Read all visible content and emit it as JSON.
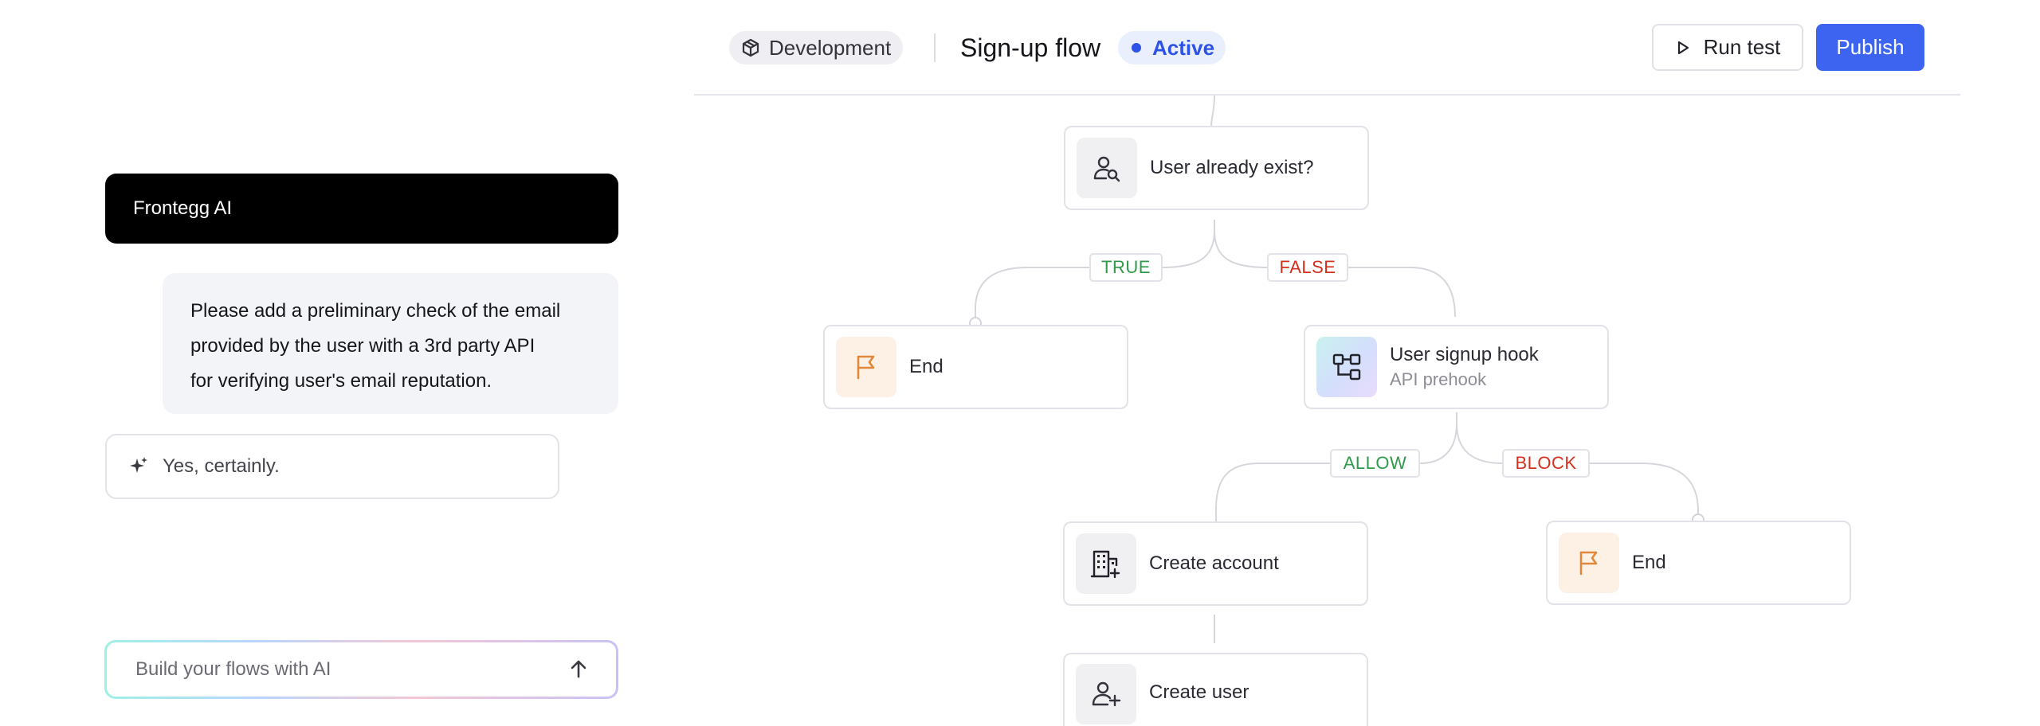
{
  "chat": {
    "header": "Frontegg AI",
    "user_message_lines": [
      "Please add a preliminary check of the email",
      "provided by the user with a 3rd party API",
      "for verifying user's email reputation."
    ],
    "ai_reply": "Yes, certainly.",
    "prompt_placeholder": "Build your flows with AI"
  },
  "topbar": {
    "environment": "Development",
    "flow_title": "Sign-up flow",
    "status": "Active",
    "run_test_label": "Run test",
    "publish_label": "Publish"
  },
  "flow": {
    "nodes": {
      "user_exists": {
        "label": "User already exist?"
      },
      "end_true": {
        "label": "End"
      },
      "signup_hook": {
        "label": "User signup hook",
        "sublabel": "API prehook"
      },
      "create_account": {
        "label": "Create account"
      },
      "end_block": {
        "label": "End"
      },
      "create_user": {
        "label": "Create user"
      }
    },
    "edges": {
      "true_label": "TRUE",
      "false_label": "FALSE",
      "allow_label": "ALLOW",
      "block_label": "BLOCK"
    }
  },
  "colors": {
    "primary": "#3c64f0",
    "status_active": "#2d52e6",
    "positive_branch": "#2f9a4a",
    "negative_branch": "#d4301e",
    "end_icon": "#e0893a"
  }
}
